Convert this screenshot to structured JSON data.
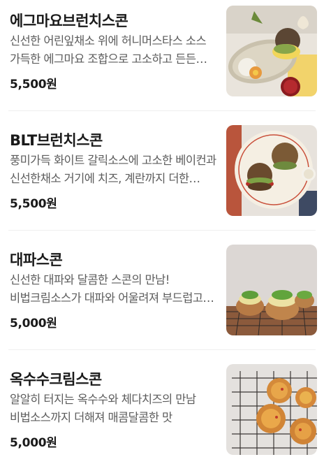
{
  "menu": [
    {
      "name": "에그마요브런치스콘",
      "description": "신선한 어린잎채소 위에 허니머스타스 소스 가득한 에그마요 조합으로 고소하고 든든한 브런치",
      "price": "5,500원",
      "photo_icon": "egg-mayo-scone-photo"
    },
    {
      "name": "BLT브런치스콘",
      "description": "풍미가득 화이트 갈릭소스에 고소한 베이컨과 신선한채소 거기에 치즈, 계란까지 더한 브런치",
      "price": "5,500원",
      "photo_icon": "blt-scone-photo"
    },
    {
      "name": "대파스콘",
      "description": "신선한 대파와 달콤한 스콘의 만남! 비법크림소스가 대파와 어울려져 부드럽고 달콤한 맛",
      "price": "5,000원",
      "photo_icon": "green-onion-scone-photo"
    },
    {
      "name": "옥수수크림스콘",
      "description": "알알히 터지는 옥수수와 체다치즈의 만남 비법소스까지 더해져 매콤달콤한 맛",
      "price": "5,000원",
      "photo_icon": "corn-cream-scone-photo"
    }
  ]
}
